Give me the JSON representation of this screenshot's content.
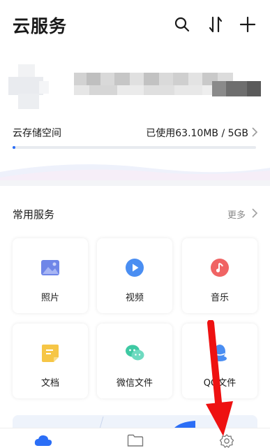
{
  "header": {
    "title": "云服务",
    "search_icon": "search-icon",
    "sort_icon": "sort-icon",
    "add_icon": "plus-icon"
  },
  "storage": {
    "label": "云存储空间",
    "usage": "已使用63.10MB / 5GB",
    "used_fraction": 0.012,
    "accent": "#2b6ef6"
  },
  "services": {
    "title": "常用服务",
    "more": "更多",
    "items": [
      {
        "label": "照片",
        "icon": "photo-icon",
        "color": "#6f86e8"
      },
      {
        "label": "视频",
        "icon": "play-icon",
        "color": "#4a8ef2"
      },
      {
        "label": "音乐",
        "icon": "music-icon",
        "color": "#f06464"
      },
      {
        "label": "文档",
        "icon": "document-icon",
        "color": "#f6c646"
      },
      {
        "label": "微信文件",
        "icon": "wechat-icon",
        "color": "#3ec9a3"
      },
      {
        "label": "QQ文件",
        "icon": "qq-icon",
        "color": "#4a8ef2"
      }
    ]
  },
  "bottom_nav": {
    "items": [
      {
        "icon": "cloud-icon",
        "color": "#2b6ef6"
      },
      {
        "icon": "folder-icon",
        "color": "#7a7a7a"
      },
      {
        "icon": "gear-icon",
        "color": "#7a7a7a"
      }
    ]
  },
  "annotation": {
    "color": "#ee1111"
  }
}
